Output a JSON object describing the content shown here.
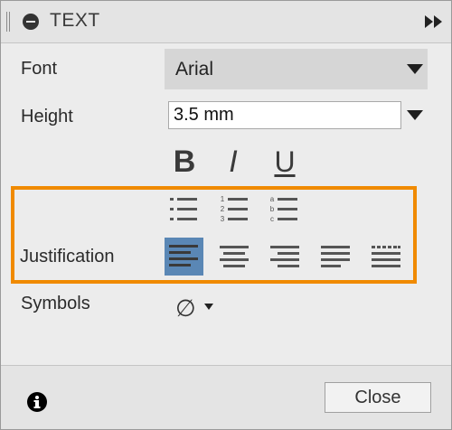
{
  "panel": {
    "title": "TEXT",
    "collapse_icon": "minus-circle-icon",
    "expand_icon": "double-chevron-right-icon"
  },
  "font": {
    "label": "Font",
    "value": "Arial"
  },
  "height": {
    "label": "Height",
    "value": "3.5 mm"
  },
  "style_buttons": {
    "bold": "B",
    "italic": "I",
    "underline": "U"
  },
  "lists": {
    "bullet_icon": "bullet-list-icon",
    "numbered_icon": "numbered-list-icon",
    "numbered_marks": [
      "1",
      "2",
      "3"
    ],
    "lettered_icon": "lettered-list-icon",
    "lettered_marks": [
      "a",
      "b",
      "c"
    ]
  },
  "justification": {
    "label": "Justification",
    "options": [
      "align-left",
      "align-center",
      "align-right",
      "justify",
      "justify-distributed"
    ],
    "selected": "align-left"
  },
  "symbols": {
    "label": "Symbols",
    "value": "∅"
  },
  "footer": {
    "info_icon": "info-icon",
    "close_label": "Close"
  },
  "colors": {
    "highlight_box": "#f08a00",
    "selected_button": "#5a87b5"
  }
}
